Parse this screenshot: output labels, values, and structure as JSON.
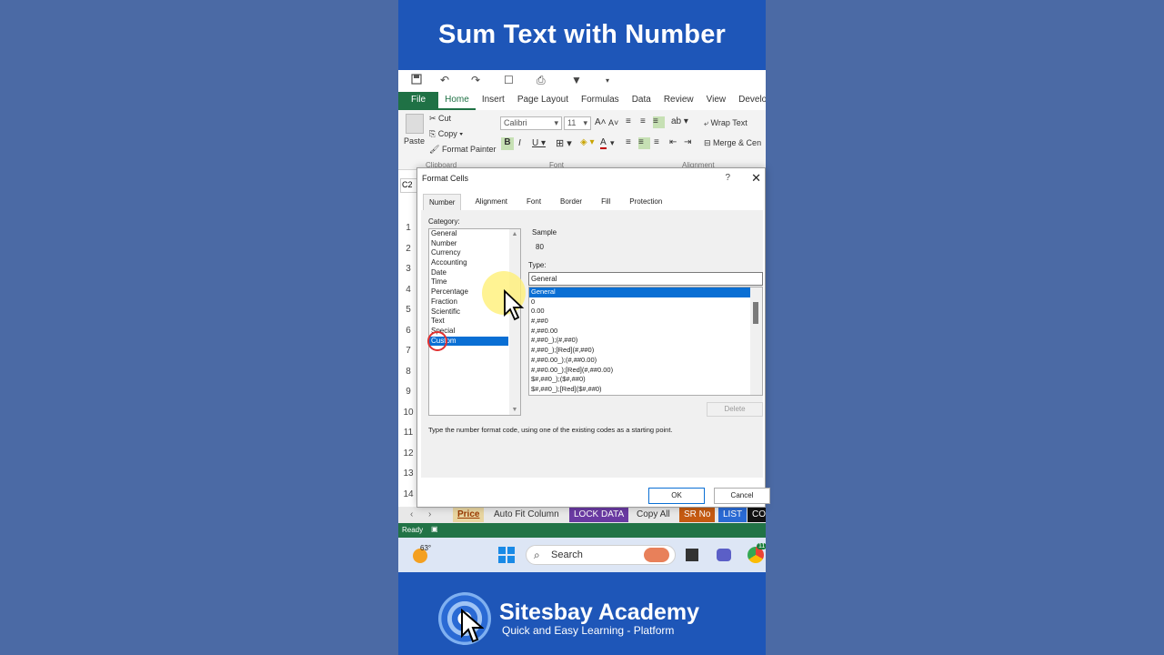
{
  "banner": {
    "title": "Sum Text with Number"
  },
  "ribbon": {
    "tabs": [
      "File",
      "Home",
      "Insert",
      "Page Layout",
      "Formulas",
      "Data",
      "Review",
      "View",
      "Developer"
    ],
    "active_tab": "Home",
    "paste_label": "Paste",
    "cut_label": "Cut",
    "copy_label": "Copy",
    "format_painter_label": "Format Painter",
    "clipboard_group": "Clipboard",
    "font_name": "Calibri",
    "font_size": "11",
    "font_group": "Font",
    "alignment_group": "Alignment",
    "wrap_text_label": "Wrap Text",
    "merge_center_label": "Merge & Cen"
  },
  "sheet": {
    "name_box": "C2",
    "row_numbers": [
      "1",
      "2",
      "3",
      "4",
      "5",
      "6",
      "7",
      "8",
      "9",
      "10",
      "11",
      "12",
      "13",
      "14"
    ]
  },
  "dialog": {
    "title": "Format Cells",
    "help": "?",
    "close": "✕",
    "tabs": [
      "Number",
      "Alignment",
      "Font",
      "Border",
      "Fill",
      "Protection"
    ],
    "active_tab": "Number",
    "category_label": "Category:",
    "categories": [
      "General",
      "Number",
      "Currency",
      "Accounting",
      "Date",
      "Time",
      "Percentage",
      "Fraction",
      "Scientific",
      "Text",
      "Special",
      "Custom"
    ],
    "selected_category": "Custom",
    "sample_label": "Sample",
    "sample_value": "80",
    "type_label": "Type:",
    "type_value": "General",
    "type_list": [
      "General",
      "0",
      "0.00",
      "#,##0",
      "#,##0.00",
      "#,##0_);(#,##0)",
      "#,##0_);[Red](#,##0)",
      "#,##0.00_);(#,##0.00)",
      "#,##0.00_);[Red](#,##0.00)",
      "$#,##0_);($#,##0)",
      "$#,##0_);[Red]($#,##0)"
    ],
    "selected_type": "General",
    "delete_label": "Delete",
    "hint": "Type the number format code, using one of the existing codes as a starting point.",
    "ok_label": "OK",
    "cancel_label": "Cancel"
  },
  "sheet_tabs": [
    {
      "label": "Price",
      "bg": "#e8d5a0",
      "color": "#9a3a00"
    },
    {
      "label": "Auto Fit Column",
      "bg": "#e8e8e8",
      "color": "#333333"
    },
    {
      "label": "LOCK DATA",
      "bg": "#6a3aa2",
      "color": "#ffffff"
    },
    {
      "label": "Copy All",
      "bg": "#e8e8e8",
      "color": "#333333"
    },
    {
      "label": "SR No",
      "bg": "#c55a11",
      "color": "#ffffff"
    },
    {
      "label": "LIST",
      "bg": "#2a6ad4",
      "color": "#ffffff"
    },
    {
      "label": "CO",
      "bg": "#111111",
      "color": "#ffffff"
    }
  ],
  "status": {
    "text": "Ready"
  },
  "taskbar": {
    "weather": "63°",
    "search_label": "Search",
    "badge": "11"
  },
  "footer": {
    "brand": "Sitesbay Academy",
    "tagline": "Quick and Easy Learning - Platform"
  }
}
